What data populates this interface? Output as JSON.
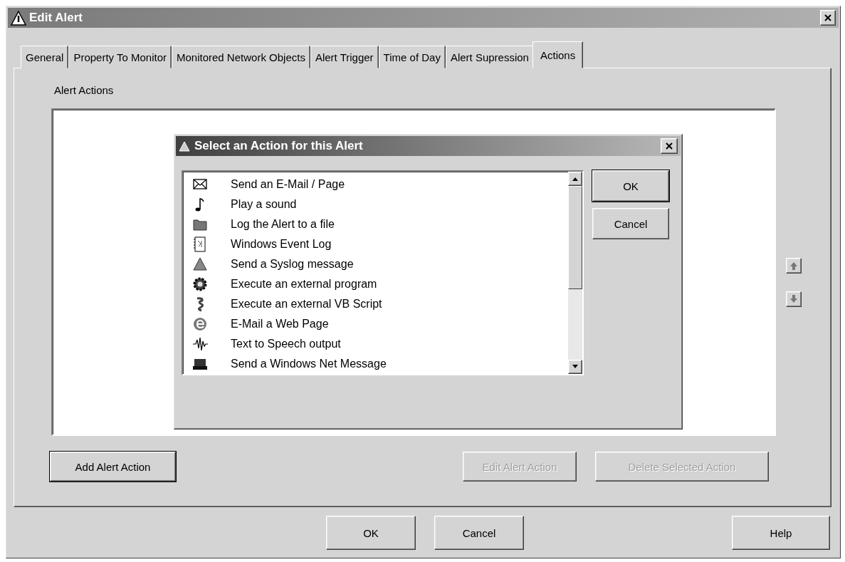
{
  "window": {
    "title": "Edit Alert"
  },
  "tabs": [
    {
      "label": "General",
      "selected": false
    },
    {
      "label": "Property To Monitor",
      "selected": false
    },
    {
      "label": "Monitored Network Objects",
      "selected": false
    },
    {
      "label": "Alert Trigger",
      "selected": false
    },
    {
      "label": "Time of Day",
      "selected": false
    },
    {
      "label": "Alert Supression",
      "selected": false
    },
    {
      "label": "Actions",
      "selected": true
    }
  ],
  "panel": {
    "label": "Alert Actions",
    "buttons": [
      {
        "label": "Add Alert Action",
        "disabled": false,
        "default": true
      },
      {
        "label": "Edit Alert Action",
        "disabled": true,
        "default": false
      },
      {
        "label": "Delete Selected Action",
        "disabled": true,
        "default": false
      }
    ]
  },
  "dialog": {
    "title": "Select an Action for this Alert",
    "actions": [
      {
        "label": "Send an E-Mail / Page",
        "selected": false
      },
      {
        "label": "Play a sound",
        "selected": false
      },
      {
        "label": "Log the Alert to a file",
        "selected": false
      },
      {
        "label": "Windows Event Log",
        "selected": false
      },
      {
        "label": "Send a Syslog message",
        "selected": false
      },
      {
        "label": "Execute an external program",
        "selected": false
      },
      {
        "label": "Execute an external VB Script",
        "selected": false
      },
      {
        "label": "E-Mail a Web Page",
        "selected": false
      },
      {
        "label": "Text to Speech output",
        "selected": false
      },
      {
        "label": "Send a Windows Net Message",
        "selected": false
      }
    ],
    "buttons": [
      {
        "label": "OK",
        "disabled": false,
        "default": true
      },
      {
        "label": "Cancel",
        "disabled": false,
        "default": false
      }
    ]
  },
  "footer_buttons": [
    {
      "label": "OK",
      "disabled": false,
      "default": false
    },
    {
      "label": "Cancel",
      "disabled": false,
      "default": false
    },
    {
      "label": "Help",
      "disabled": false,
      "default": false
    }
  ]
}
